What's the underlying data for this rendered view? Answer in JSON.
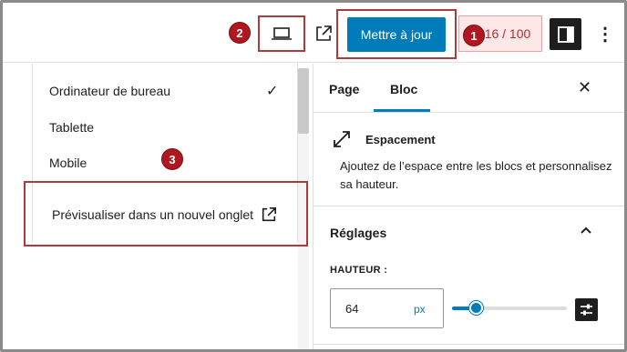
{
  "toolbar": {
    "update_label": "Mettre à jour",
    "score_label": "16 / 100",
    "more_label": "⋮"
  },
  "badges": {
    "one": "1",
    "two": "2",
    "three": "3"
  },
  "preview_menu": {
    "items": [
      "Ordinateur de bureau",
      "Tablette",
      "Mobile"
    ],
    "selected": "Ordinateur de bureau",
    "check": "✓",
    "new_tab_label": "Prévisualiser dans un nouvel onglet"
  },
  "sidebar": {
    "tabs": [
      "Page",
      "Bloc"
    ],
    "active_tab": "Bloc",
    "close": "✕",
    "block": {
      "title": "Espacement",
      "description": "Ajoutez de l’espace entre les blocs et personnalisez sa hauteur."
    },
    "settings_title": "Réglages",
    "height_label": "HAUTEUR :",
    "height_value": "64",
    "height_unit": "px",
    "slider_fraction": 0.21
  },
  "colors": {
    "accent": "#007cba",
    "highlight_border": "#b03a3a",
    "badge": "#b01820",
    "score_bg": "#fde7e7",
    "score_text": "#b32d2e"
  }
}
